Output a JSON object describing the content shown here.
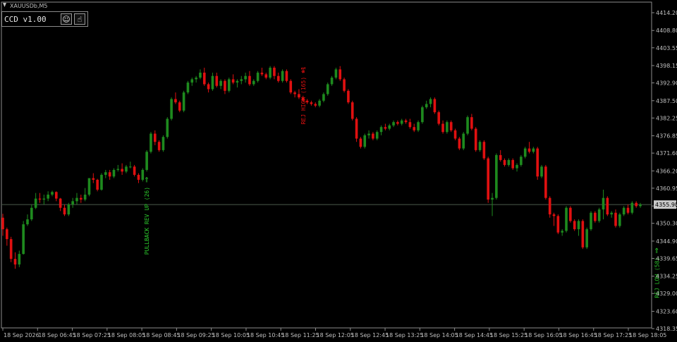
{
  "symbol_label": "XAUUSDb,M5",
  "panel": {
    "title": "CCD v1.00",
    "buttons": [
      {
        "name": "smiley",
        "glyph": "☺"
      },
      {
        "name": "hand",
        "glyph": "☝"
      }
    ]
  },
  "colors": {
    "background": "#000000",
    "up_candle": "#1e8a1e",
    "down_candle": "#e01010",
    "axis": "#8c8c8c",
    "current_price_line": "#4a5a4a",
    "price_tag_bg": "#c8c8c8",
    "annotation_up": "#2cc82c",
    "annotation_down": "#e01010"
  },
  "chart_data": {
    "type": "candlestick",
    "ylim": [
      4318.35,
      4414.2
    ],
    "y_ticks": [
      "4414.20",
      "4408.80",
      "4403.55",
      "4398.15",
      "4392.90",
      "4387.50",
      "4382.25",
      "4376.85",
      "4371.60",
      "4366.20",
      "4360.95",
      "4355.55",
      "4350.30",
      "4344.90",
      "4339.65",
      "4334.25",
      "4329.00",
      "4323.60",
      "4318.35"
    ],
    "current_price": 4355.98,
    "current_price_label": "4355.98",
    "x_tick_labels": [
      "18 Sep 2026",
      "18 Sep 06:45",
      "18 Sep 07:25",
      "18 Sep 08:05",
      "18 Sep 08:45",
      "18 Sep 09:25",
      "18 Sep 10:05",
      "18 Sep 10:45",
      "18 Sep 11:25",
      "18 Sep 12:05",
      "18 Sep 12:45",
      "18 Sep 13:25",
      "18 Sep 14:05",
      "18 Sep 14:45",
      "18 Sep 15:25",
      "18 Sep 16:05",
      "18 Sep 16:45",
      "18 Sep 17:25",
      "18 Sep 18:05"
    ],
    "candles": [
      [
        4352.0,
        4353.2,
        4346.5,
        4348.5
      ],
      [
        4348.5,
        4349.0,
        4343.5,
        4345.5
      ],
      [
        4345.5,
        4346.2,
        4338.5,
        4339.5
      ],
      [
        4339.5,
        4341.5,
        4336.5,
        4337.8
      ],
      [
        4337.8,
        4342.0,
        4337.0,
        4341.0
      ],
      [
        4341.0,
        4351.0,
        4340.8,
        4350.0
      ],
      [
        4350.0,
        4353.0,
        4349.5,
        4351.5
      ],
      [
        4351.5,
        4356.0,
        4351.0,
        4355.0
      ],
      [
        4355.0,
        4359.5,
        4354.6,
        4357.8
      ],
      [
        4357.8,
        4359.5,
        4356.5,
        4357.5
      ],
      [
        4357.5,
        4359.0,
        4356.0,
        4357.8
      ],
      [
        4357.8,
        4360.0,
        4357.0,
        4359.0
      ],
      [
        4359.0,
        4360.2,
        4358.5,
        4359.8
      ],
      [
        4359.8,
        4360.0,
        4357.0,
        4357.8
      ],
      [
        4357.8,
        4358.0,
        4354.0,
        4355.0
      ],
      [
        4355.0,
        4356.0,
        4352.5,
        4353.0
      ],
      [
        4353.0,
        4356.5,
        4352.5,
        4356.0
      ],
      [
        4356.0,
        4358.0,
        4355.0,
        4357.0
      ],
      [
        4357.0,
        4359.5,
        4356.0,
        4358.0
      ],
      [
        4358.0,
        4359.0,
        4356.5,
        4357.5
      ],
      [
        4357.5,
        4361.0,
        4357.0,
        4359.0
      ],
      [
        4359.0,
        4364.0,
        4358.5,
        4364.0
      ],
      [
        4364.0,
        4365.5,
        4362.5,
        4363.5
      ],
      [
        4363.5,
        4363.8,
        4360.0,
        4360.5
      ],
      [
        4360.5,
        4365.5,
        4360.2,
        4365.0
      ],
      [
        4365.0,
        4366.5,
        4364.0,
        4365.8
      ],
      [
        4365.8,
        4366.5,
        4363.5,
        4364.5
      ],
      [
        4364.5,
        4367.0,
        4364.0,
        4366.5
      ],
      [
        4366.5,
        4368.0,
        4366.0,
        4366.8
      ],
      [
        4366.8,
        4368.5,
        4365.0,
        4366.0
      ],
      [
        4366.0,
        4368.0,
        4365.5,
        4367.5
      ],
      [
        4367.5,
        4369.0,
        4367.0,
        4367.5
      ],
      [
        4367.5,
        4368.0,
        4364.5,
        4365.0
      ],
      [
        4365.0,
        4365.5,
        4362.5,
        4363.5
      ],
      [
        4363.5,
        4367.0,
        4363.0,
        4366.5
      ],
      [
        4366.5,
        4372.5,
        4366.0,
        4372.0
      ],
      [
        4372.0,
        4378.0,
        4371.5,
        4377.5
      ],
      [
        4377.5,
        4378.5,
        4374.0,
        4375.0
      ],
      [
        4375.0,
        4375.5,
        4372.0,
        4372.5
      ],
      [
        4372.5,
        4377.0,
        4372.0,
        4376.5
      ],
      [
        4376.5,
        4382.5,
        4376.0,
        4382.0
      ],
      [
        4382.0,
        4388.5,
        4381.5,
        4388.0
      ],
      [
        4388.0,
        4390.0,
        4386.5,
        4387.0
      ],
      [
        4387.0,
        4387.5,
        4384.0,
        4384.5
      ],
      [
        4384.5,
        4390.5,
        4384.0,
        4390.0
      ],
      [
        4390.0,
        4393.5,
        4389.5,
        4393.0
      ],
      [
        4393.0,
        4394.5,
        4392.0,
        4394.0
      ],
      [
        4394.0,
        4395.0,
        4393.0,
        4394.5
      ],
      [
        4394.5,
        4397.0,
        4394.0,
        4396.0
      ],
      [
        4396.0,
        4397.5,
        4392.0,
        4392.5
      ],
      [
        4392.5,
        4393.0,
        4390.0,
        4391.0
      ],
      [
        4391.0,
        4396.0,
        4390.5,
        4395.0
      ],
      [
        4395.0,
        4396.0,
        4391.5,
        4392.0
      ],
      [
        4392.0,
        4394.0,
        4391.0,
        4393.5
      ],
      [
        4393.5,
        4394.0,
        4389.5,
        4390.5
      ],
      [
        4390.5,
        4394.5,
        4390.0,
        4394.0
      ],
      [
        4394.0,
        4395.5,
        4392.5,
        4393.0
      ],
      [
        4393.0,
        4394.0,
        4391.5,
        4393.5
      ],
      [
        4393.5,
        4395.0,
        4392.5,
        4394.0
      ],
      [
        4394.0,
        4396.0,
        4393.0,
        4395.0
      ],
      [
        4395.0,
        4396.5,
        4392.0,
        4392.5
      ],
      [
        4392.5,
        4394.0,
        4392.0,
        4393.5
      ],
      [
        4393.5,
        4396.5,
        4393.0,
        4396.0
      ],
      [
        4396.0,
        4397.5,
        4395.0,
        4395.5
      ],
      [
        4395.5,
        4396.0,
        4394.0,
        4394.5
      ],
      [
        4394.5,
        4398.0,
        4394.0,
        4397.5
      ],
      [
        4397.5,
        4398.0,
        4394.0,
        4395.0
      ],
      [
        4395.0,
        4396.0,
        4393.0,
        4393.5
      ],
      [
        4393.5,
        4397.0,
        4393.0,
        4396.5
      ],
      [
        4396.5,
        4397.0,
        4393.0,
        4393.5
      ],
      [
        4393.5,
        4394.0,
        4389.5,
        4390.0
      ],
      [
        4390.0,
        4390.5,
        4388.5,
        4389.5
      ],
      [
        4389.5,
        4391.0,
        4388.0,
        4388.5
      ],
      [
        4388.5,
        4389.0,
        4387.0,
        4387.5
      ],
      [
        4387.5,
        4388.0,
        4386.5,
        4387.0
      ],
      [
        4387.0,
        4387.5,
        4386.0,
        4386.5
      ],
      [
        4386.5,
        4387.0,
        4385.5,
        4386.0
      ],
      [
        4386.0,
        4388.0,
        4385.5,
        4387.5
      ],
      [
        4387.5,
        4390.0,
        4387.0,
        4389.5
      ],
      [
        4389.5,
        4393.0,
        4389.0,
        4392.5
      ],
      [
        4392.5,
        4395.0,
        4392.0,
        4394.5
      ],
      [
        4394.5,
        4397.5,
        4394.0,
        4397.0
      ],
      [
        4397.0,
        4398.0,
        4393.5,
        4394.0
      ],
      [
        4394.0,
        4394.5,
        4390.0,
        4390.5
      ],
      [
        4390.5,
        4391.0,
        4386.5,
        4387.0
      ],
      [
        4387.0,
        4387.5,
        4381.5,
        4382.0
      ],
      [
        4382.0,
        4382.5,
        4375.0,
        4376.0
      ],
      [
        4376.0,
        4376.5,
        4373.0,
        4373.5
      ],
      [
        4373.5,
        4377.5,
        4373.0,
        4377.0
      ],
      [
        4377.0,
        4378.5,
        4376.0,
        4377.5
      ],
      [
        4377.5,
        4378.0,
        4375.5,
        4376.0
      ],
      [
        4376.0,
        4378.5,
        4375.5,
        4378.0
      ],
      [
        4378.0,
        4380.0,
        4377.0,
        4379.5
      ],
      [
        4379.5,
        4380.5,
        4378.5,
        4379.0
      ],
      [
        4379.0,
        4380.5,
        4378.5,
        4380.0
      ],
      [
        4380.0,
        4381.5,
        4379.5,
        4381.0
      ],
      [
        4381.0,
        4381.5,
        4380.0,
        4380.5
      ],
      [
        4380.5,
        4382.0,
        4380.0,
        4381.5
      ],
      [
        4381.5,
        4382.0,
        4380.5,
        4381.0
      ],
      [
        4381.0,
        4382.0,
        4379.0,
        4379.5
      ],
      [
        4379.5,
        4380.5,
        4378.0,
        4378.5
      ],
      [
        4378.5,
        4381.5,
        4378.0,
        4381.0
      ],
      [
        4381.0,
        4386.0,
        4380.5,
        4385.5
      ],
      [
        4385.5,
        4387.5,
        4385.0,
        4386.5
      ],
      [
        4386.5,
        4388.5,
        4385.5,
        4388.0
      ],
      [
        4388.0,
        4388.5,
        4383.5,
        4384.0
      ],
      [
        4384.0,
        4384.5,
        4380.0,
        4380.5
      ],
      [
        4380.5,
        4381.5,
        4377.5,
        4378.0
      ],
      [
        4378.0,
        4381.5,
        4377.5,
        4381.0
      ],
      [
        4381.0,
        4381.5,
        4378.0,
        4378.5
      ],
      [
        4378.5,
        4379.0,
        4375.5,
        4376.0
      ],
      [
        4376.0,
        4376.5,
        4372.5,
        4373.0
      ],
      [
        4373.0,
        4378.0,
        4372.5,
        4377.5
      ],
      [
        4377.5,
        4383.0,
        4377.0,
        4382.5
      ],
      [
        4382.5,
        4383.5,
        4378.5,
        4379.0
      ],
      [
        4379.0,
        4379.5,
        4372.0,
        4372.5
      ],
      [
        4372.5,
        4375.5,
        4372.0,
        4375.0
      ],
      [
        4375.0,
        4375.5,
        4369.5,
        4370.0
      ],
      [
        4370.0,
        4370.5,
        4356.5,
        4357.5
      ],
      [
        4357.5,
        4359.5,
        4352.5,
        4358.0
      ],
      [
        4358.0,
        4371.5,
        4357.5,
        4371.0
      ],
      [
        4371.0,
        4372.5,
        4369.0,
        4369.5
      ],
      [
        4369.5,
        4370.0,
        4367.5,
        4368.0
      ],
      [
        4368.0,
        4370.0,
        4367.5,
        4369.5
      ],
      [
        4369.5,
        4370.0,
        4366.5,
        4367.0
      ],
      [
        4367.0,
        4368.5,
        4366.0,
        4368.0
      ],
      [
        4368.0,
        4371.0,
        4367.5,
        4370.5
      ],
      [
        4370.5,
        4373.5,
        4370.0,
        4373.0
      ],
      [
        4373.0,
        4375.0,
        4371.5,
        4372.0
      ],
      [
        4372.0,
        4373.5,
        4371.5,
        4373.0
      ],
      [
        4373.0,
        4373.5,
        4363.5,
        4364.5
      ],
      [
        4364.5,
        4368.0,
        4364.0,
        4367.5
      ],
      [
        4367.5,
        4368.0,
        4357.5,
        4358.0
      ],
      [
        4358.0,
        4358.5,
        4352.0,
        4353.0
      ],
      [
        4353.0,
        4353.5,
        4349.5,
        4352.5
      ],
      [
        4352.5,
        4353.0,
        4347.0,
        4347.5
      ],
      [
        4347.5,
        4348.5,
        4346.5,
        4348.0
      ],
      [
        4348.0,
        4355.5,
        4347.5,
        4355.0
      ],
      [
        4355.0,
        4355.5,
        4350.5,
        4351.0
      ],
      [
        4351.0,
        4351.5,
        4348.0,
        4348.5
      ],
      [
        4348.5,
        4351.5,
        4346.5,
        4351.0
      ],
      [
        4351.0,
        4351.5,
        4342.5,
        4343.0
      ],
      [
        4343.0,
        4349.0,
        4342.5,
        4348.5
      ],
      [
        4348.5,
        4354.0,
        4348.0,
        4353.5
      ],
      [
        4353.5,
        4354.0,
        4350.5,
        4351.0
      ],
      [
        4351.0,
        4355.0,
        4350.5,
        4354.5
      ],
      [
        4354.5,
        4360.5,
        4351.5,
        4358.0
      ],
      [
        4358.0,
        4358.5,
        4352.5,
        4353.0
      ],
      [
        4353.0,
        4354.0,
        4352.0,
        4353.5
      ],
      [
        4353.5,
        4354.5,
        4349.0,
        4349.5
      ],
      [
        4349.5,
        4353.5,
        4349.0,
        4353.0
      ],
      [
        4353.0,
        4355.5,
        4352.5,
        4355.0
      ],
      [
        4355.0,
        4356.0,
        4353.0,
        4353.5
      ],
      [
        4353.5,
        4357.0,
        4353.0,
        4356.5
      ],
      [
        4356.5,
        4357.0,
        4355.0,
        4355.5
      ],
      [
        4355.5,
        4356.5,
        4355.0,
        4356.0
      ]
    ],
    "annotations": [
      {
        "text": "PULLBACK REV UP (26)",
        "arrow": "⇑",
        "candle_index": 35,
        "price": 4364.5,
        "side": "below",
        "kind": "up"
      },
      {
        "text": "REJ HIGH (165) ×1",
        "arrow": "⇓",
        "candle_index": 73,
        "price": 4395.5,
        "side": "above",
        "kind": "down"
      },
      {
        "text": "REJ LOW (58)",
        "arrow": "⇑",
        "candle_index": 159,
        "price": 4343.0,
        "side": "below",
        "kind": "up"
      }
    ]
  }
}
